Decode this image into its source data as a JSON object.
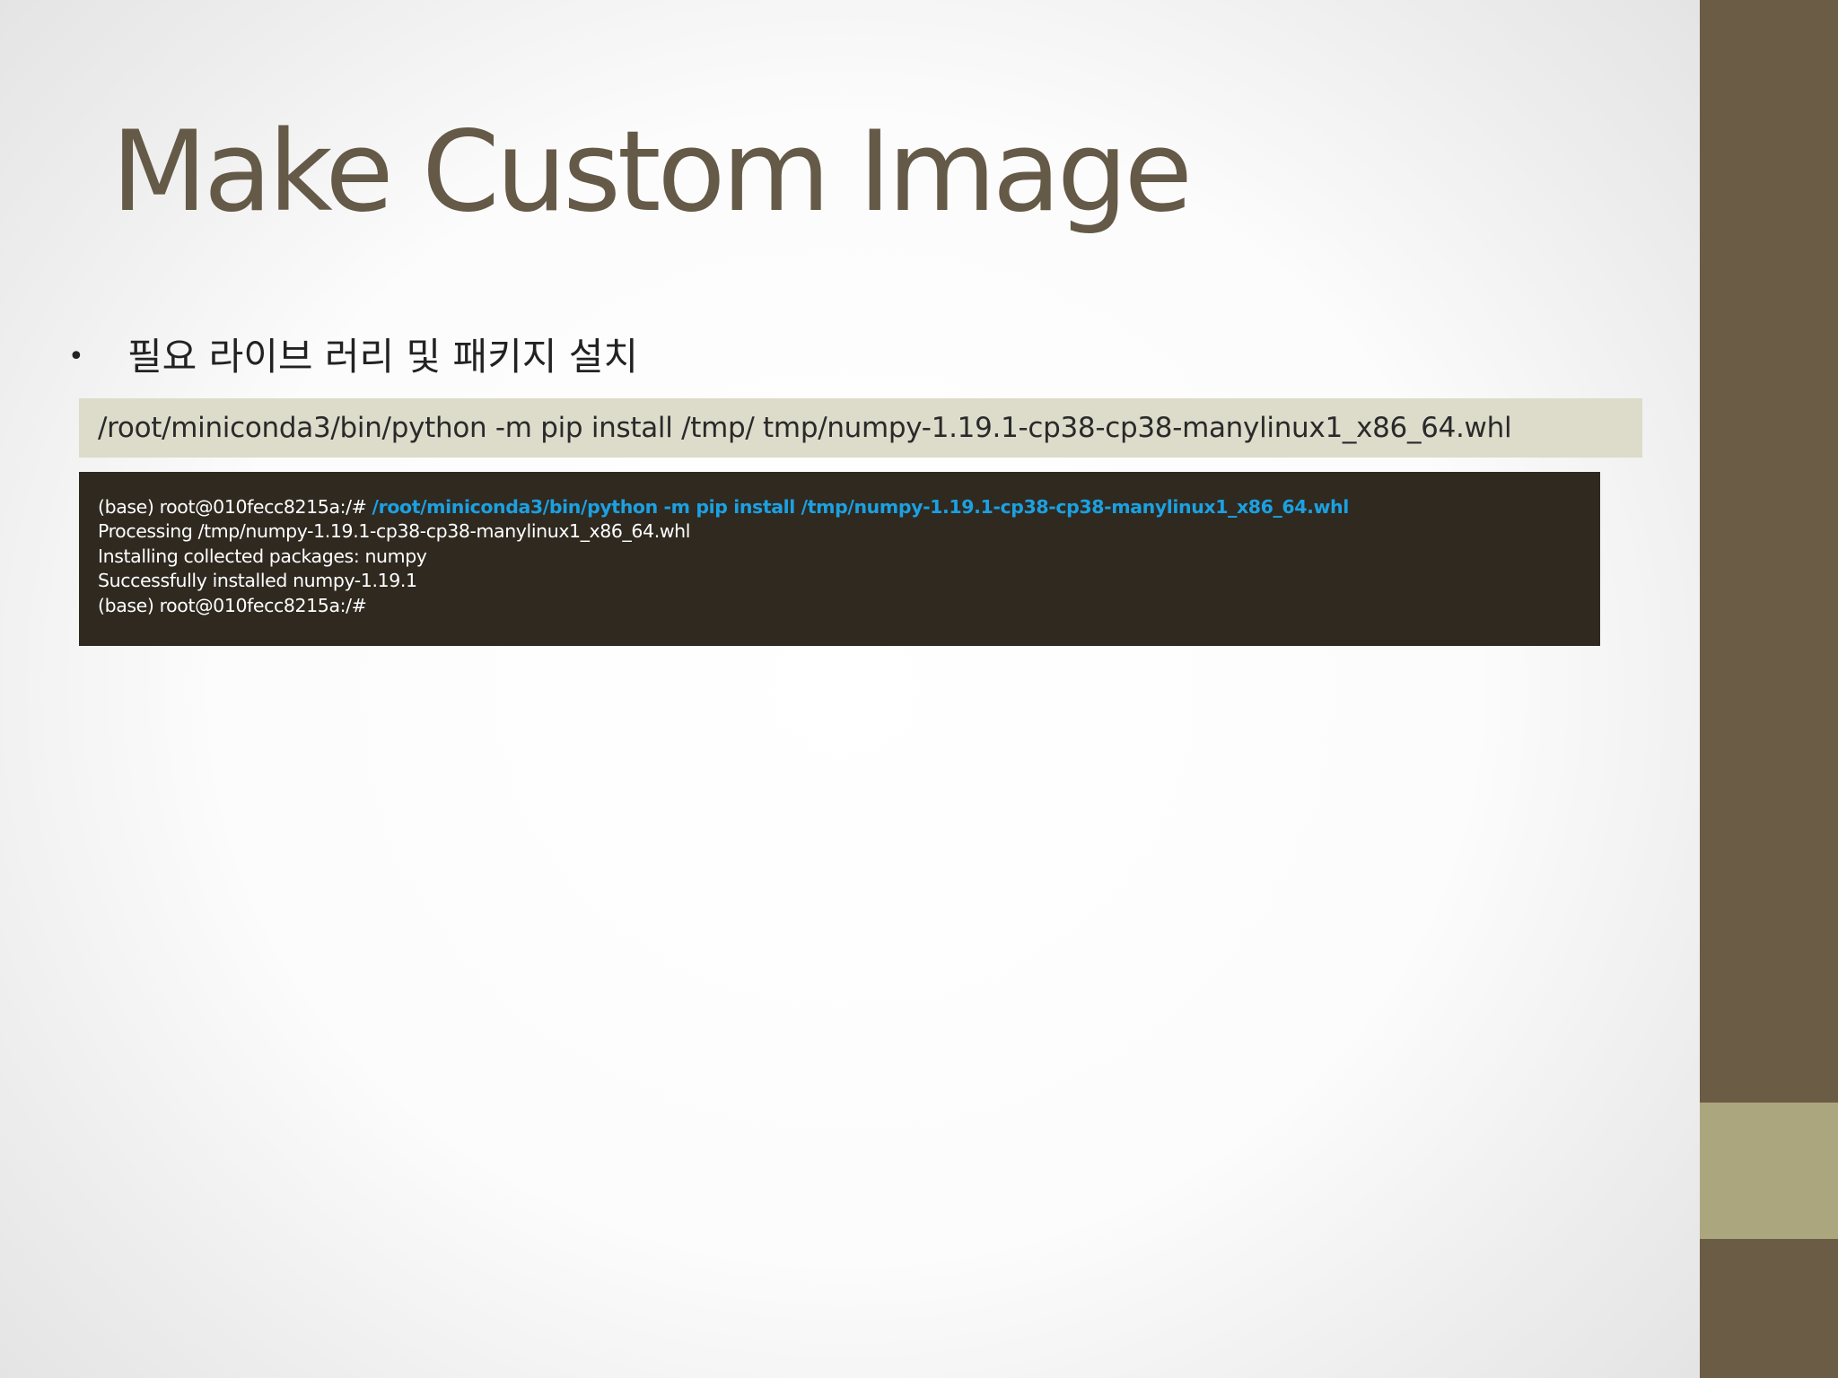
{
  "slide": {
    "title": "Make Custom Image",
    "bullet": {
      "marker": "•",
      "text": "필요 라이브 러리 및 패키지 설치"
    },
    "command": "/root/miniconda3/bin/python -m pip install /tmp/ tmp/numpy-1.19.1-cp38-cp38-manylinux1_x86_64.whl",
    "terminal": {
      "prompt": "(base) root@010fecc8215a:/# ",
      "command": "/root/miniconda3/bin/python -m pip install /tmp/numpy-1.19.1-cp38-cp38-manylinux1_x86_64.whl",
      "output": [
        "Processing /tmp/numpy-1.19.1-cp38-cp38-manylinux1_x86_64.whl",
        "Installing collected packages: numpy",
        "Successfully installed numpy-1.19.1",
        "(base) root@010fecc8215a:/#"
      ]
    }
  },
  "colors": {
    "title": "#645a47",
    "side_bar_dark": "#6a5c45",
    "side_bar_accent": "#aca67e",
    "command_box_bg": "#dddbca",
    "terminal_bg": "#2f2920",
    "terminal_text": "#ffffff",
    "terminal_command": "#1ba1e2"
  }
}
